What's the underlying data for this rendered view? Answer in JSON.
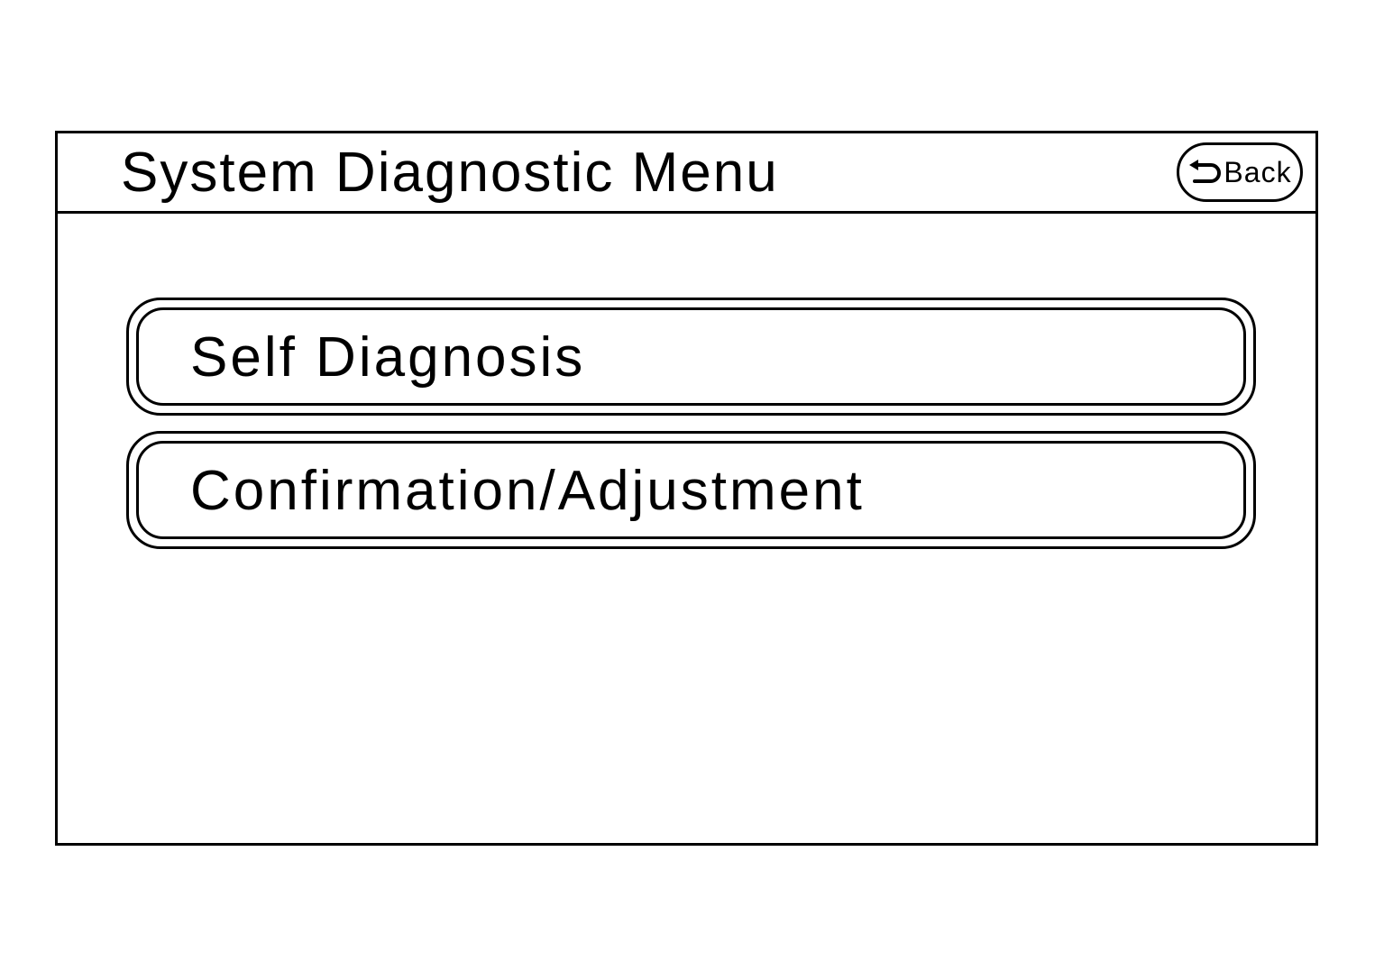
{
  "header": {
    "title": "System Diagnostic Menu",
    "back_icon": "return-arrow-icon",
    "back_label": "Back"
  },
  "menu": {
    "items": [
      {
        "label": "Self Diagnosis"
      },
      {
        "label": "Confirmation/Adjustment"
      }
    ]
  },
  "colors": {
    "foreground": "#000000",
    "background": "#ffffff"
  }
}
